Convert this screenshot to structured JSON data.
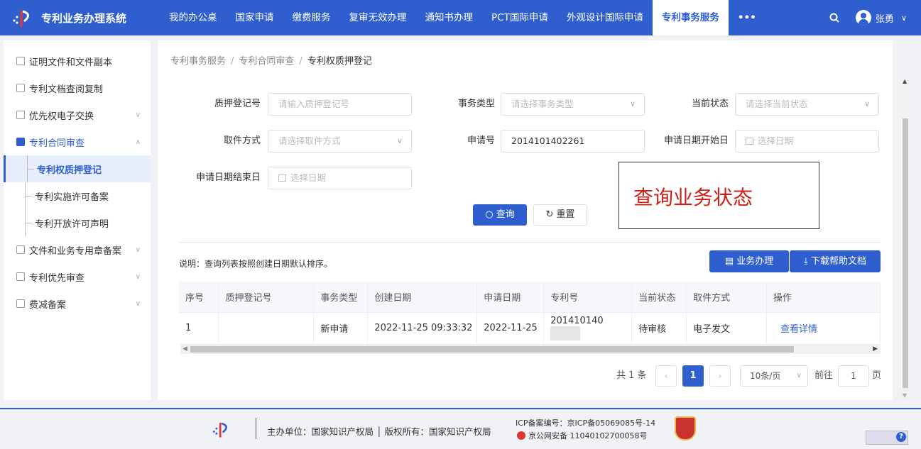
{
  "app": {
    "title": "专利业务办理系统"
  },
  "nav": {
    "items": [
      "我的办公桌",
      "国家申请",
      "缴费服务",
      "复审无效办理",
      "通知书办理",
      "PCT国际申请",
      "外观设计国际申请",
      "专利事务服务"
    ],
    "active": "专利事务服务",
    "more": "•••",
    "user": "张勇"
  },
  "sidebar": {
    "items": [
      {
        "label": "证明文件和文件副本"
      },
      {
        "label": "专利文档查阅复制"
      },
      {
        "label": "优先权电子交换"
      },
      {
        "label": "专利合同审查"
      },
      {
        "label": "文件和业务专用章备案"
      },
      {
        "label": "专利优先审查"
      },
      {
        "label": "费减备案"
      }
    ],
    "sub": [
      "专利权质押登记",
      "专利实施许可备案",
      "专利开放许可声明"
    ]
  },
  "breadcrumb": {
    "l1": "专利事务服务",
    "l2": "专利合同审查",
    "l3": "专利权质押登记",
    "sep": "/"
  },
  "form": {
    "pledge_no_label": "质押登记号",
    "pledge_no_placeholder": "请输入质押登记号",
    "biz_type_label": "事务类型",
    "biz_type_placeholder": "请选择事务类型",
    "status_label": "当前状态",
    "status_placeholder": "请选择当前状态",
    "fetch_label": "取件方式",
    "fetch_placeholder": "请选择取件方式",
    "app_no_label": "申请号",
    "app_no_value": "2014101402261",
    "start_label": "申请日期开始日",
    "start_placeholder": "选择日期",
    "end_label": "申请日期结束日",
    "end_placeholder": "选择日期",
    "query": "查询",
    "reset": "重置"
  },
  "overlay": {
    "text": "查询业务状态"
  },
  "list": {
    "note": "说明：查询列表按照创建日期默认排序。",
    "handle_btn": "业务办理",
    "download_btn": "下载帮助文档",
    "columns": [
      "序号",
      "质押登记号",
      "事务类型",
      "创建日期",
      "申请日期",
      "专利号",
      "当前状态",
      "取件方式",
      "操作"
    ],
    "rows": [
      {
        "idx": "1",
        "pledge_no": "",
        "type": "新申请",
        "created": "2022-11-25 09:33:32",
        "applied": "2022-11-25",
        "patent_no": "201410140",
        "status": "待审核",
        "fetch": "电子发文",
        "action": "查看详情"
      }
    ]
  },
  "pager": {
    "total": "共 1 条",
    "current": "1",
    "size": "10条/页",
    "goto": "前往",
    "goto_value": "1",
    "page_unit": "页"
  },
  "footer": {
    "host": "主办单位：国家知识产权局 │ 版权所有：国家知识产权局",
    "icp": "ICP备案编号：京ICP备05069085号-14",
    "police": "京公网安备 11040102700058号",
    "badge": "党政机关"
  },
  "colors": {
    "primary": "#2f5fcf",
    "overlay_text": "#d0201a"
  }
}
